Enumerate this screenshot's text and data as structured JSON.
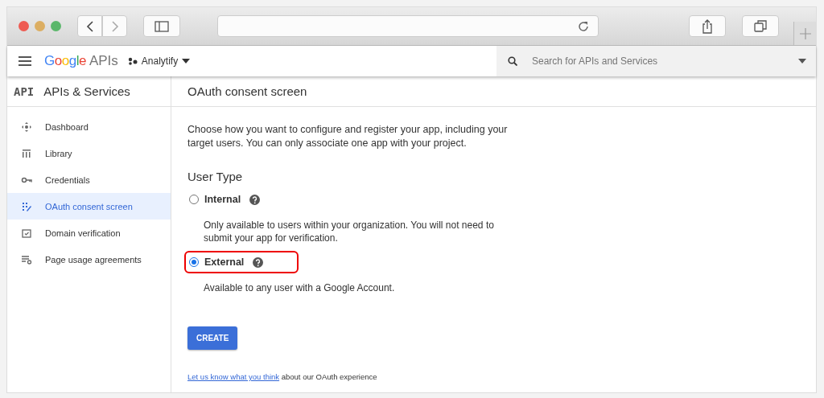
{
  "app_bar": {
    "logo": "Google",
    "product": "APIs",
    "project": "Analytify",
    "search": {
      "placeholder": "Search for APIs and Services"
    }
  },
  "sidebar": {
    "badge": "API",
    "title": "APIs & Services",
    "items": [
      {
        "label": "Dashboard",
        "selected": false
      },
      {
        "label": "Library",
        "selected": false
      },
      {
        "label": "Credentials",
        "selected": false
      },
      {
        "label": "OAuth consent screen",
        "selected": true
      },
      {
        "label": "Domain verification",
        "selected": false
      },
      {
        "label": "Page usage agreements",
        "selected": false
      }
    ]
  },
  "content": {
    "title": "OAuth consent screen",
    "intro": "Choose how you want to configure and register your app, including your target users. You can only associate one app with your project.",
    "section": "User Type",
    "options": [
      {
        "label": "Internal",
        "selected": false,
        "highlighted": false,
        "description": "Only available to users within your organization. You will not need to submit your app for verification."
      },
      {
        "label": "External",
        "selected": true,
        "highlighted": true,
        "description": "Available to any user with a Google Account."
      }
    ],
    "button": "CREATE",
    "feedback_link": "Let us know what you think",
    "feedback_text": "about our OAuth experience"
  }
}
